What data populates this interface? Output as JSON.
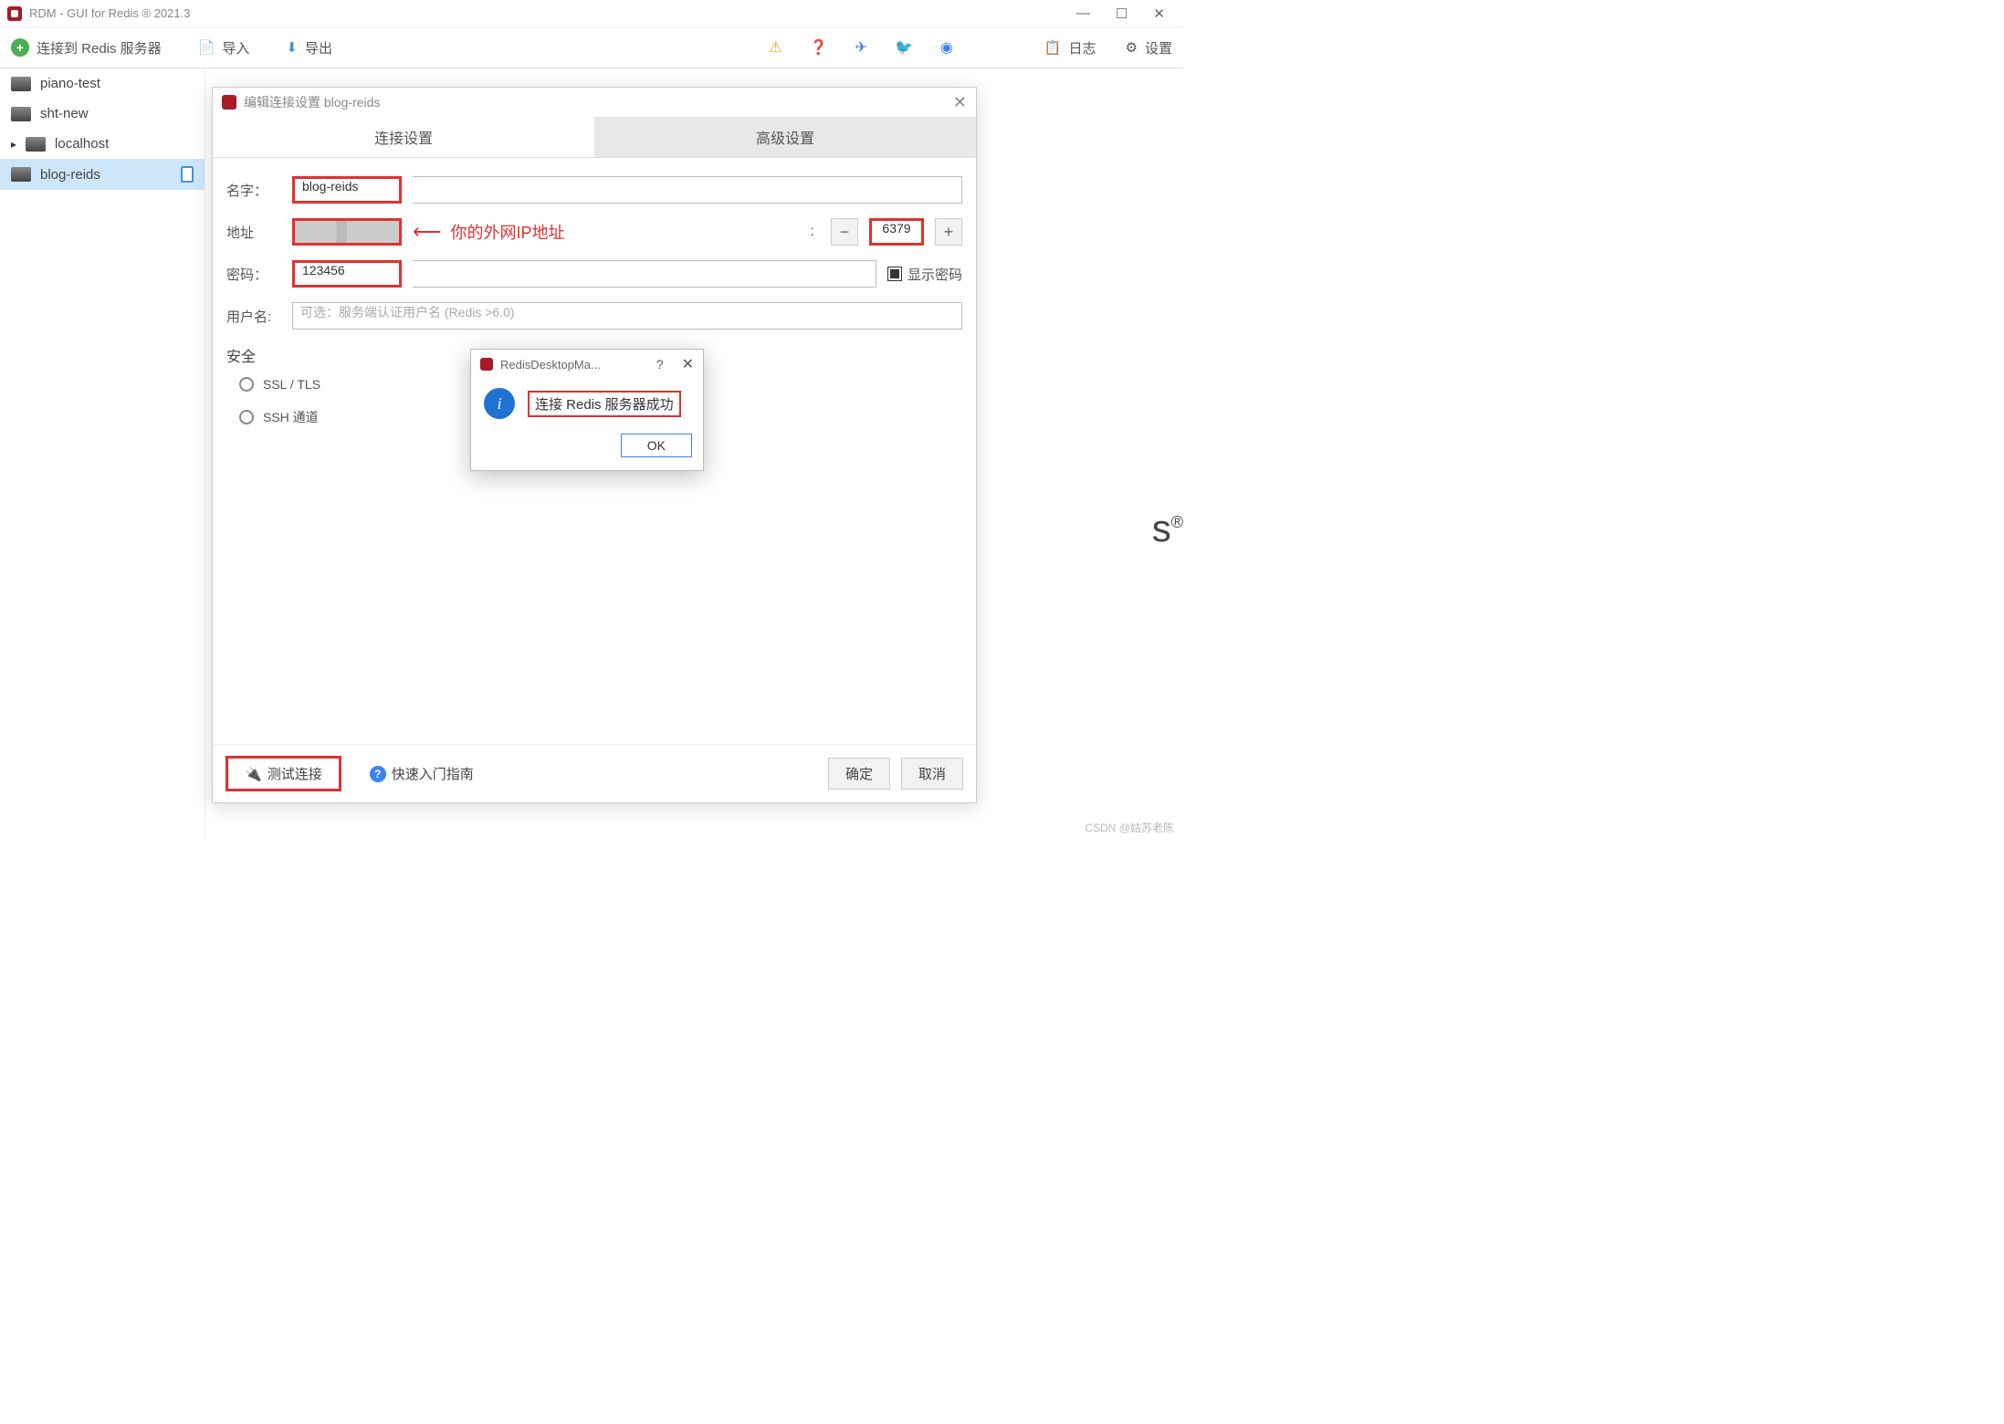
{
  "window": {
    "title": "RDM - GUI for Redis ® 2021.3"
  },
  "toolbar": {
    "connect_label": "连接到 Redis 服务器",
    "import_label": "导入",
    "export_label": "导出",
    "log_label": "日志",
    "settings_label": "设置"
  },
  "connections": [
    {
      "name": "piano-test",
      "selected": false,
      "expanded": false
    },
    {
      "name": "sht-new",
      "selected": false,
      "expanded": false
    },
    {
      "name": "localhost",
      "selected": false,
      "expanded": true
    },
    {
      "name": "blog-reids",
      "selected": true,
      "expanded": false
    }
  ],
  "dialog": {
    "title": "编辑连接设置 blog-reids",
    "tabs": {
      "connection": "连接设置",
      "advanced": "高级设置"
    },
    "labels": {
      "name": "名字：",
      "address": "地址",
      "password": "密码：",
      "username": "用户名:",
      "security": "安全",
      "ssl": "SSL / TLS",
      "ssh": "SSH 通道"
    },
    "values": {
      "name": "blog-reids",
      "address": "",
      "port": "6379",
      "password": "123456",
      "username_placeholder": "可选：服务端认证用户名 (Redis >6.0)"
    },
    "show_password": "显示密码",
    "annotation": "你的外网IP地址",
    "footer": {
      "test": "测试连接",
      "guide": "快速入门指南",
      "ok": "确定",
      "cancel": "取消"
    }
  },
  "msgbox": {
    "title": "RedisDesktopMa...",
    "message": "连接 Redis 服务器成功",
    "ok": "OK"
  },
  "bg_text": "s",
  "watermark": "CSDN @姑苏老陈"
}
